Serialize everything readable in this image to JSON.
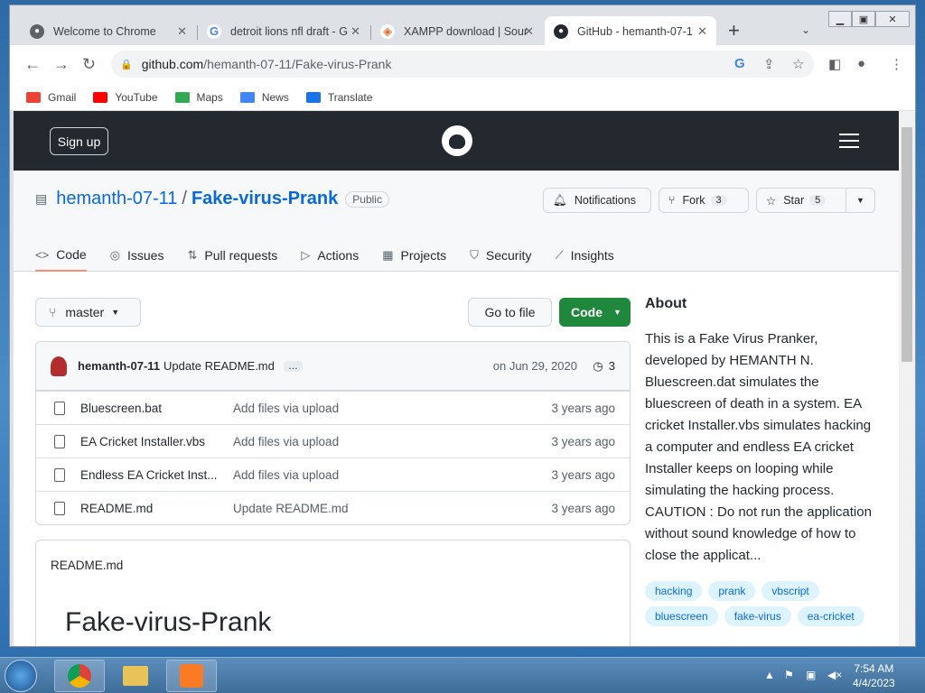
{
  "browser": {
    "tabs": [
      {
        "title": "Welcome to Chrome",
        "favicon": "chrome-icon"
      },
      {
        "title": "detroit lions nfl draft - G",
        "favicon": "google-icon"
      },
      {
        "title": "XAMPP download | Sour",
        "favicon": "sourceforge-icon"
      },
      {
        "title": "GitHub - hemanth-07-1",
        "favicon": "github-icon"
      }
    ],
    "url_host": "github.com",
    "url_path": "/hemanth-07-11/Fake-virus-Prank",
    "bookmarks": [
      "Gmail",
      "YouTube",
      "Maps",
      "News",
      "Translate"
    ]
  },
  "header": {
    "signup": "Sign up"
  },
  "repo": {
    "owner": "hemanth-07-11",
    "slash": "/",
    "name": "Fake-virus-Prank",
    "visibility": "Public",
    "notifications": "Notifications",
    "fork": "Fork",
    "fork_count": "3",
    "star": "Star",
    "star_count": "5",
    "tabs": [
      "Code",
      "Issues",
      "Pull requests",
      "Actions",
      "Projects",
      "Security",
      "Insights"
    ]
  },
  "branch": "master",
  "goto_file": "Go to file",
  "code_button": "Code",
  "commit": {
    "author": "hemanth-07-11",
    "message": "Update README.md",
    "ellipsis": "…",
    "date": "on Jun 29, 2020",
    "count": "3"
  },
  "files": [
    {
      "name": "Bluescreen.bat",
      "message": "Add files via upload",
      "age": "3 years ago"
    },
    {
      "name": "EA Cricket Installer.vbs",
      "message": "Add files via upload",
      "age": "3 years ago"
    },
    {
      "name": "Endless EA Cricket Inst...",
      "message": "Add files via upload",
      "age": "3 years ago"
    },
    {
      "name": "README.md",
      "message": "Update README.md",
      "age": "3 years ago"
    }
  ],
  "readme": {
    "label": "README.md",
    "title": "Fake-virus-Prank"
  },
  "about": {
    "heading": "About",
    "description": "This is a Fake Virus Pranker, developed by HEMANTH N. Bluescreen.dat simulates the bluescreen of death in a system. EA cricket Installer.vbs simulates hacking a computer and endless EA cricket Installer keeps on looping while simulating the hacking process. CAUTION : Do not run the application without sound knowledge of how to close the applicat...",
    "topics": [
      "hacking",
      "prank",
      "vbscript",
      "bluescreen",
      "fake-virus",
      "ea-cricket"
    ]
  },
  "taskbar": {
    "time": "7:54 AM",
    "date": "4/4/2023"
  }
}
